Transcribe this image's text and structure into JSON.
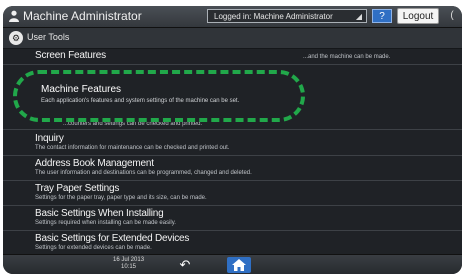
{
  "header": {
    "title": "Machine Administrator",
    "login_status": "Logged in: Machine Administrator",
    "help_label": "?",
    "logout_label": "Logout"
  },
  "subheader": {
    "title": "User Tools"
  },
  "highlighted_item": {
    "title": "Machine Features",
    "description": "Each application's features and system settings of the machine can be set."
  },
  "items": [
    {
      "title": "Screen Features",
      "description": "...and the machine can be made."
    },
    {
      "title": "",
      "description": "...counters and settings can be checked and printed."
    },
    {
      "title": "Inquiry",
      "description": "The contact information for maintenance can be checked and printed out."
    },
    {
      "title": "Address Book Management",
      "description": "The user information and destinations can be programmed, changed and deleted."
    },
    {
      "title": "Tray Paper Settings",
      "description": "Settings for the paper tray, paper type and its size, can be made."
    },
    {
      "title": "Basic Settings When Installing",
      "description": "Settings required when installing can be made easily."
    },
    {
      "title": "Basic Settings for Extended Devices",
      "description": "Settings for extended devices can be made."
    }
  ],
  "footer": {
    "date": "16 Jul 2013",
    "time": "10:15"
  },
  "colors": {
    "highlight": "#21a84a",
    "accent": "#2f6fc4"
  }
}
